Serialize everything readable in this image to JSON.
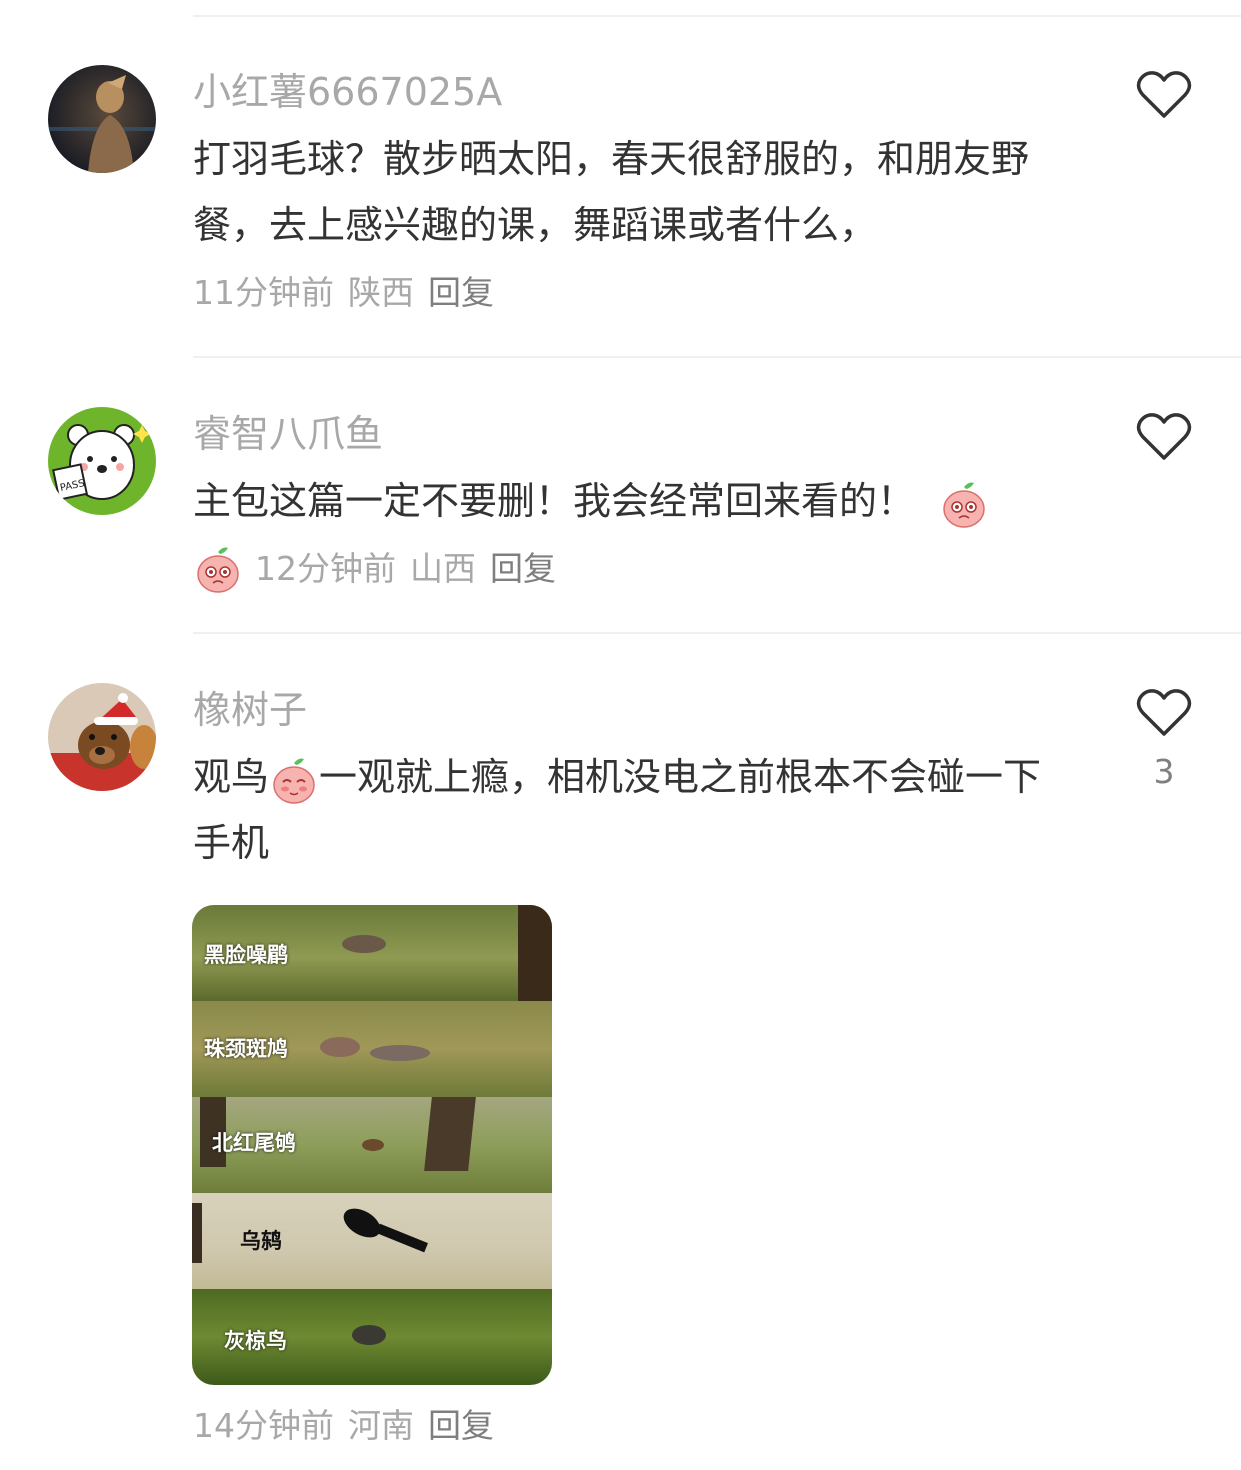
{
  "comments": [
    {
      "username": "小红薯6667025A",
      "text": "打羽毛球？散步晒太阳，春天很舒服的，和朋友野餐，去上感兴趣的课，舞蹈课或者什么，",
      "time": "11分钟前",
      "region": "陕西",
      "reply": "回复",
      "avatar_icon": "woman-night-photo-avatar",
      "like_count": ""
    },
    {
      "username": "睿智八爪鱼",
      "text_before_emoji": "主包这篇一定不要删！我会经常回来看的！",
      "time": "12分钟前",
      "region": "山西",
      "reply": "回复",
      "avatar_icon": "cartoon-bear-pass-avatar",
      "emoji_icon": "crying-peach-emoji",
      "like_count": ""
    },
    {
      "username": "橡树子",
      "text_part1": "观鸟",
      "text_part2": "一观就上瘾，相机没电之前根本不会碰一下手机",
      "time": "14分钟前",
      "region": "河南",
      "reply": "回复",
      "avatar_icon": "dog-santa-hat-avatar",
      "emoji_icon": "shy-peach-emoji",
      "like_count": "3",
      "photo_labels": [
        "黑脸噪鹛",
        "珠颈斑鸠",
        "北红尾鸲",
        "乌鸫",
        "灰椋鸟"
      ]
    }
  ],
  "colors": {
    "username": "#a8a8a8",
    "text": "#333333",
    "meta": "#a8a8a8",
    "reply": "#7f7f7f",
    "divider": "#f0f0f0"
  }
}
